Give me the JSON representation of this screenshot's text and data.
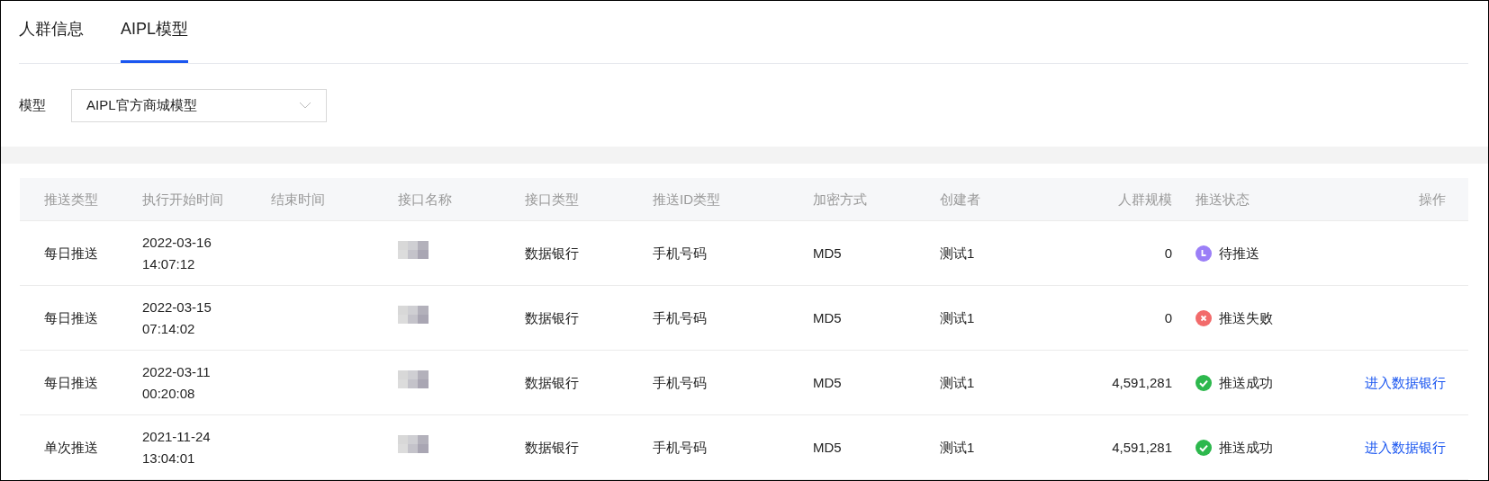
{
  "tabs": [
    {
      "label": "人群信息",
      "selected": false
    },
    {
      "label": "AIPL模型",
      "selected": true
    }
  ],
  "filter": {
    "label": "模型",
    "value": "AIPL官方商城模型"
  },
  "table": {
    "columns": [
      "推送类型",
      "执行开始时间",
      "结束时间",
      "接口名称",
      "接口类型",
      "推送ID类型",
      "加密方式",
      "创建者",
      "人群规模",
      "推送状态",
      "操作"
    ],
    "rows": [
      {
        "push_type": "每日推送",
        "start_date": "2022-03-16",
        "start_time": "14:07:12",
        "api_type": "数据银行",
        "id_type": "手机号码",
        "encryption": "MD5",
        "creator": "测试1",
        "size": "0",
        "status": {
          "kind": "pending",
          "label": "待推送"
        }
      },
      {
        "push_type": "每日推送",
        "start_date": "2022-03-15",
        "start_time": "07:14:02",
        "api_type": "数据银行",
        "id_type": "手机号码",
        "encryption": "MD5",
        "creator": "测试1",
        "size": "0",
        "status": {
          "kind": "failed",
          "label": "推送失败"
        }
      },
      {
        "push_type": "每日推送",
        "start_date": "2022-03-11",
        "start_time": "00:20:08",
        "api_type": "数据银行",
        "id_type": "手机号码",
        "encryption": "MD5",
        "creator": "测试1",
        "size": "4,591,281",
        "status": {
          "kind": "success",
          "label": "推送成功"
        },
        "action": "进入数据银行"
      },
      {
        "push_type": "单次推送",
        "start_date": "2021-11-24",
        "start_time": "13:04:01",
        "api_type": "数据银行",
        "id_type": "手机号码",
        "encryption": "MD5",
        "creator": "测试1",
        "size": "4,591,281",
        "status": {
          "kind": "success",
          "label": "推送成功"
        },
        "action": "进入数据银行"
      }
    ]
  }
}
